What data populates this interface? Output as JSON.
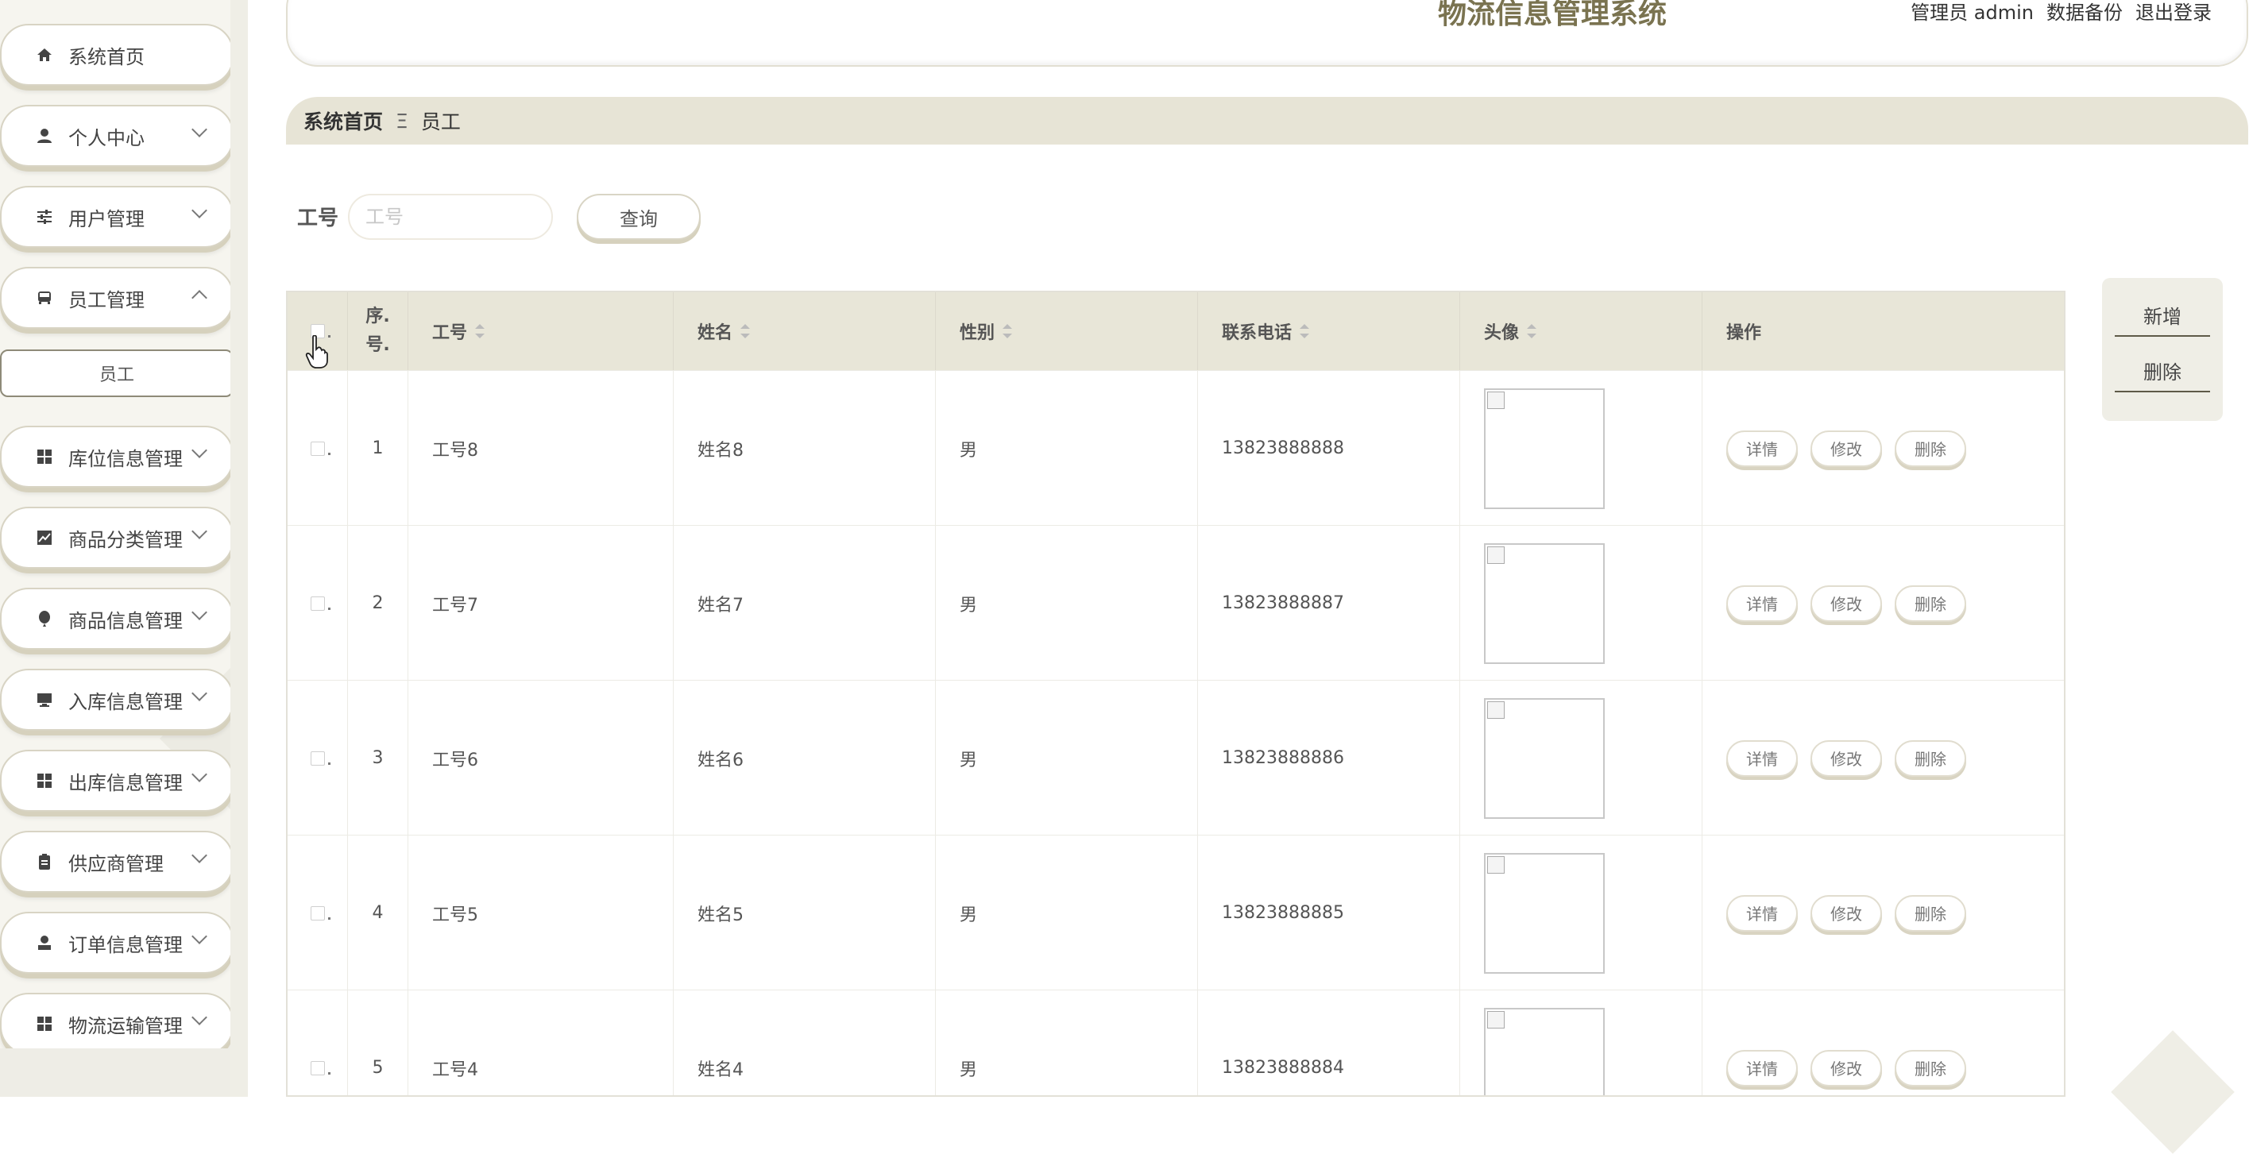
{
  "header": {
    "title": "物流信息管理系统",
    "role_label": "管理员",
    "username": "admin",
    "backup_link": "数据备份",
    "logout_link": "退出登录"
  },
  "sidebar": {
    "items": [
      {
        "label": "系统首页",
        "icon": "home-icon",
        "has_arrow": false
      },
      {
        "label": "个人中心",
        "icon": "person-icon",
        "has_arrow": true
      },
      {
        "label": "用户管理",
        "icon": "sliders-icon",
        "has_arrow": true
      },
      {
        "label": "员工管理",
        "icon": "bus-icon",
        "has_arrow": true,
        "expanded": true
      },
      {
        "label": "库位信息管理",
        "icon": "grid-icon",
        "has_arrow": true
      },
      {
        "label": "商品分类管理",
        "icon": "chart-icon",
        "has_arrow": true
      },
      {
        "label": "商品信息管理",
        "icon": "balloon-icon",
        "has_arrow": true
      },
      {
        "label": "入库信息管理",
        "icon": "monitor-icon",
        "has_arrow": true
      },
      {
        "label": "出库信息管理",
        "icon": "grid-icon",
        "has_arrow": true
      },
      {
        "label": "供应商管理",
        "icon": "clipboard-icon",
        "has_arrow": true
      },
      {
        "label": "订单信息管理",
        "icon": "user-icon",
        "has_arrow": true
      },
      {
        "label": "物流运输管理",
        "icon": "grid-icon",
        "has_arrow": true
      }
    ],
    "submenu_item": "员工"
  },
  "breadcrumb": {
    "home": "系统首页",
    "separator": "Ξ",
    "current": "员工"
  },
  "search": {
    "label": "工号",
    "placeholder": "工号",
    "value": "",
    "button": "查询"
  },
  "table": {
    "columns": {
      "seq_line1": "序.",
      "seq_line2": "号.",
      "id": "工号",
      "name": "姓名",
      "gender": "性别",
      "phone": "联系电话",
      "avatar": "头像",
      "ops": "操作"
    },
    "rows": [
      {
        "seq": "1",
        "id": "工号8",
        "name": "姓名8",
        "gender": "男",
        "phone": "13823888888"
      },
      {
        "seq": "2",
        "id": "工号7",
        "name": "姓名7",
        "gender": "男",
        "phone": "13823888887"
      },
      {
        "seq": "3",
        "id": "工号6",
        "name": "姓名6",
        "gender": "男",
        "phone": "13823888886"
      },
      {
        "seq": "4",
        "id": "工号5",
        "name": "姓名5",
        "gender": "男",
        "phone": "13823888885"
      },
      {
        "seq": "5",
        "id": "工号4",
        "name": "姓名4",
        "gender": "男",
        "phone": "13823888884"
      }
    ],
    "row_actions": {
      "detail": "详情",
      "edit": "修改",
      "delete": "删除"
    }
  },
  "actions": {
    "add": "新增",
    "delete": "删除"
  },
  "colors": {
    "accent": "#7a7350",
    "header_bg": "#e8e6d8",
    "sidebar_bg": "#f6f5ef"
  }
}
